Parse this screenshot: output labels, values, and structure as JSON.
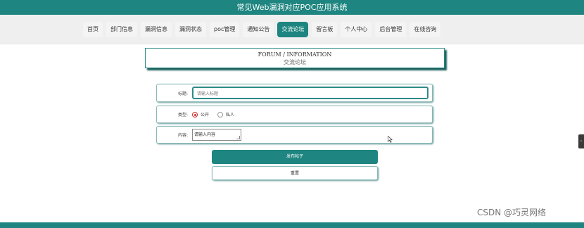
{
  "app": {
    "title": "常见Web漏洞对应POC应用系统"
  },
  "nav": {
    "items": [
      {
        "label": "首页"
      },
      {
        "label": "部门信息"
      },
      {
        "label": "漏洞信息"
      },
      {
        "label": "漏洞状态"
      },
      {
        "label": "poc管理"
      },
      {
        "label": "通知公告"
      },
      {
        "label": "交流论坛"
      },
      {
        "label": "留言板"
      },
      {
        "label": "个人中心"
      },
      {
        "label": "后台管理"
      },
      {
        "label": "在线咨询"
      }
    ],
    "active_index": 6
  },
  "banner": {
    "en": "FORUM / INFORMATION",
    "cn": "交流论坛"
  },
  "form": {
    "title_label": "标题:",
    "title_placeholder": "请输入标题",
    "type_label": "类型:",
    "type_options": [
      "公开",
      "私人"
    ],
    "type_selected": "公开",
    "content_label": "内容:",
    "content_placeholder": "请输入内容",
    "submit_label": "发布帖子",
    "reset_label": "重置"
  },
  "side_tab": {
    "label": "‹"
  },
  "watermark": {
    "text": "CSDN @巧灵网络"
  },
  "colors": {
    "accent": "#1e8580",
    "radio_selected": "#cc2b2b"
  }
}
